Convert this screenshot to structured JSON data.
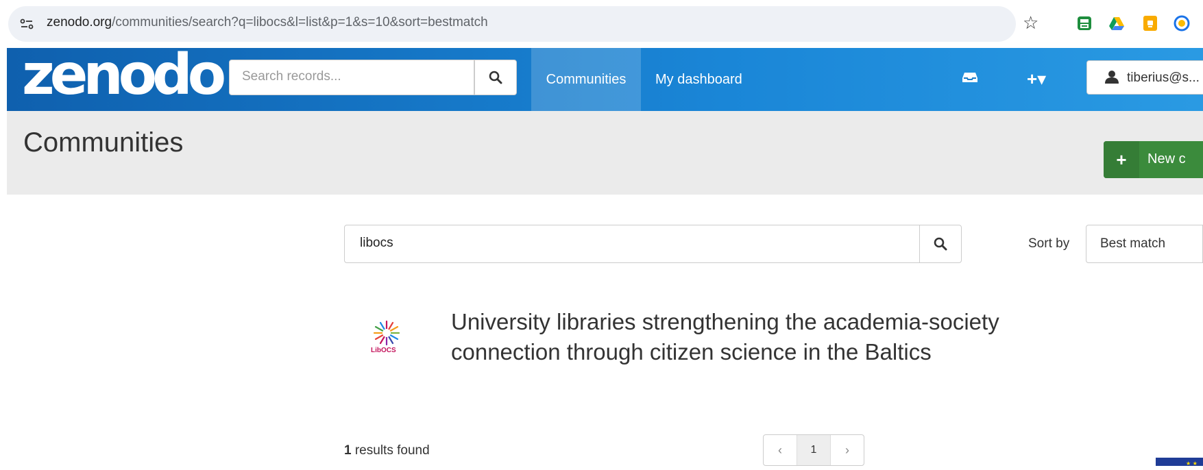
{
  "browser": {
    "url_host": "zenodo.org",
    "url_path": "/communities/search?q=libocs&l=list&p=1&s=10&sort=bestmatch",
    "star_icon": "bookmark-star-icon",
    "extensions": [
      "printer-extension-icon",
      "google-drive-icon",
      "keep-notes-icon",
      "compass-extension-icon"
    ]
  },
  "navbar": {
    "logo": "zenodo",
    "search_placeholder": "Search records...",
    "links": {
      "communities": "Communities",
      "dashboard": "My dashboard"
    },
    "plus_menu": "+▾",
    "user": "tiberius@s..."
  },
  "header": {
    "title": "Communities",
    "new_button": "New c"
  },
  "search": {
    "query": "libocs",
    "sort_label": "Sort by",
    "sort_value": "Best match"
  },
  "results": [
    {
      "logo_text": "LibOCS",
      "title": "University libraries strengthening the academia-society connection through citizen science in the Baltics"
    }
  ],
  "footer": {
    "count": "1",
    "count_label": " results found",
    "pagination": {
      "prev": "‹",
      "current": "1",
      "next": "›"
    }
  },
  "colors": {
    "navbar_start": "#0f60ae",
    "navbar_end": "#2a9ae3",
    "new_button": "#3b8b3c",
    "header_band": "#ebebeb",
    "logo_accent": "#c4145c"
  }
}
